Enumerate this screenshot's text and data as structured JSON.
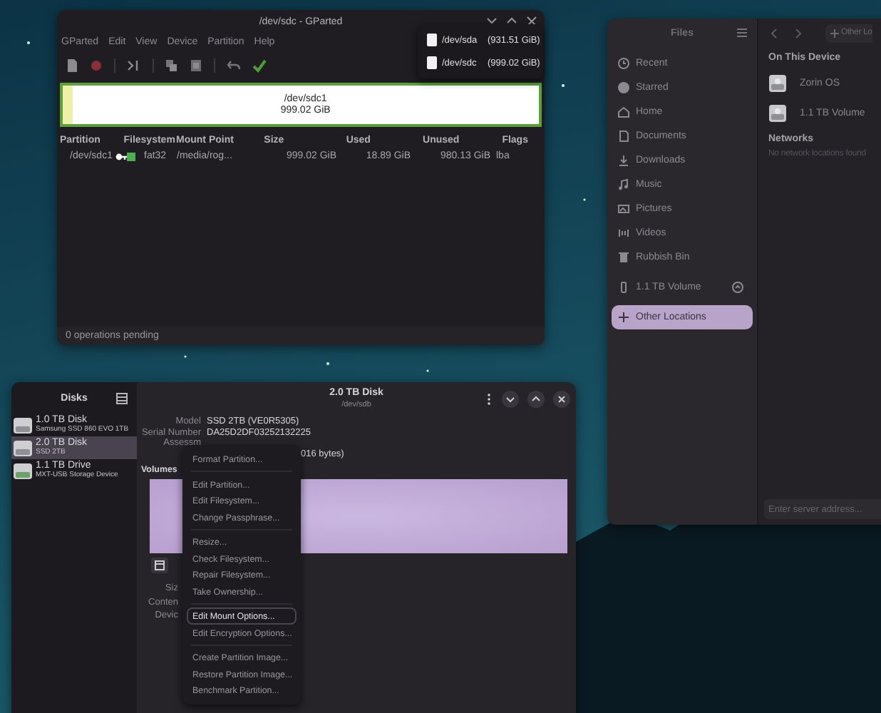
{
  "gparted": {
    "title": "/dev/sdc - GParted",
    "menu": [
      "GParted",
      "Edit",
      "View",
      "Device",
      "Partition",
      "Help"
    ],
    "partition_bar": {
      "name": "/dev/sdc1",
      "size": "999.02 GiB",
      "level": 0.02
    },
    "columns": [
      "Partition",
      "Filesystem",
      "Mount Point",
      "Size",
      "Used",
      "Unused",
      "Flags"
    ],
    "rows": [
      {
        "partition": "/dev/sdc1",
        "filesystem": "fat32",
        "mount_point": "/media/rog...",
        "size": "999.02 GiB",
        "used": "18.89 GiB",
        "unused": "980.13 GiB",
        "flags": "lba"
      }
    ],
    "status": "0 operations pending",
    "device_menu": [
      {
        "device": "/dev/sda",
        "size": "(931.51 GiB)"
      },
      {
        "device": "/dev/sdc",
        "size": "(999.02 GiB)"
      }
    ]
  },
  "files": {
    "title": "Files",
    "sidebar": [
      {
        "label": "Recent",
        "kind": "recent",
        "selected": false
      },
      {
        "label": "Starred",
        "kind": "starred",
        "selected": false
      },
      {
        "label": "Home",
        "kind": "home",
        "selected": false
      },
      {
        "label": "Documents",
        "kind": "documents",
        "selected": false
      },
      {
        "label": "Downloads",
        "kind": "downloads",
        "selected": false
      },
      {
        "label": "Music",
        "kind": "music",
        "selected": false
      },
      {
        "label": "Pictures",
        "kind": "pictures",
        "selected": false
      },
      {
        "label": "Videos",
        "kind": "videos",
        "selected": false
      },
      {
        "label": "Rubbish Bin",
        "kind": "trash",
        "selected": false
      },
      {
        "label": "1.1 TB Volume",
        "kind": "volume",
        "selected": false
      },
      {
        "label": "Other Locations",
        "kind": "other",
        "selected": true
      }
    ],
    "path_button": "Other Lo",
    "device_heading": "On This Device",
    "devices": [
      {
        "label": "Zorin OS"
      },
      {
        "label": "1.1 TB Volume"
      }
    ],
    "network_heading": "Networks",
    "network_empty": "No network locations found",
    "server_field": {
      "placeholder": "Enter server address..."
    }
  },
  "disks": {
    "title": "Disks",
    "drives": [
      {
        "name": "1.0 TB Disk",
        "model": "Samsung SSD 860 EVO 1TB",
        "kind": "disk",
        "selected": false
      },
      {
        "name": "2.0 TB Disk",
        "model": "SSD 2TB",
        "kind": "disk",
        "selected": true
      },
      {
        "name": "1.1 TB Drive",
        "model": "MXT-USB Storage Device",
        "kind": "usb",
        "selected": false
      }
    ],
    "heading": "2.0 TB Disk",
    "subheading": "/dev/sdb",
    "info": [
      {
        "label": "Model",
        "value": "SSD 2TB (VE0R5305)"
      },
      {
        "label": "Serial Number",
        "value": "DA25D2DF03252132225"
      },
      {
        "label": "Assessm"
      },
      {
        "value": "016 bytes)"
      }
    ],
    "volumes_label": "Volumes",
    "volume_labels": [
      "Siz",
      "Conten",
      "Devic"
    ],
    "context_menu": [
      {
        "items": [
          {
            "label": "Format Partition...",
            "selected": false
          }
        ]
      },
      {
        "items": [
          {
            "label": "Edit Partition...",
            "selected": false
          },
          {
            "label": "Edit Filesystem...",
            "selected": false
          },
          {
            "label": "Change Passphrase...",
            "selected": false
          }
        ]
      },
      {
        "items": [
          {
            "label": "Resize...",
            "selected": false
          },
          {
            "label": "Check Filesystem...",
            "selected": false
          },
          {
            "label": "Repair Filesystem...",
            "selected": false
          },
          {
            "label": "Take Ownership...",
            "selected": false
          }
        ]
      },
      {
        "items": [
          {
            "label": "Edit Mount Options...",
            "selected": true
          },
          {
            "label": "Edit Encryption Options...",
            "selected": false
          }
        ]
      },
      {
        "items": [
          {
            "label": "Create Partition Image...",
            "selected": false
          },
          {
            "label": "Restore Partition Image...",
            "selected": false
          },
          {
            "label": "Benchmark Partition...",
            "selected": false
          }
        ]
      }
    ]
  }
}
